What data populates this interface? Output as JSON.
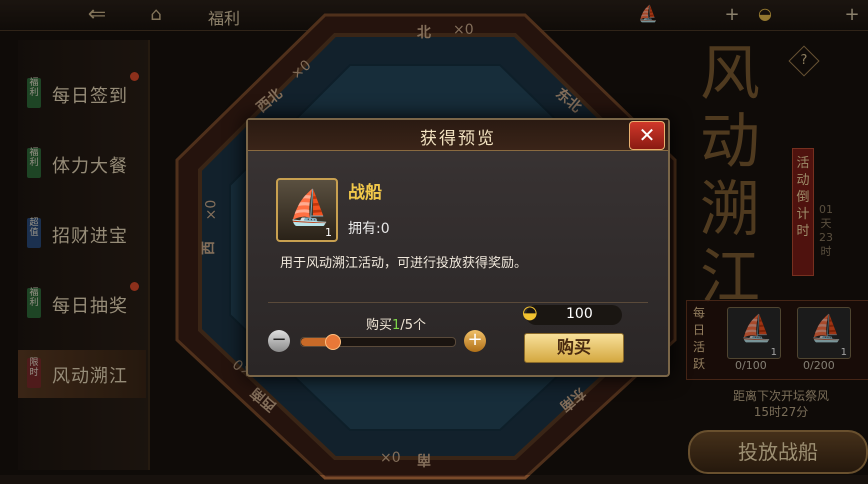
{
  "topbar": {
    "back_icon": "back-arrow-icon",
    "home_icon": "home-icon",
    "title": "福利",
    "resource1_icon": "ship-resource-icon",
    "resource2_icon": "gold-ingot-icon"
  },
  "sidebar": {
    "items": [
      {
        "tag": "福利",
        "label": "每日签到",
        "badge": true,
        "tag_color": "#2f6a3a"
      },
      {
        "tag": "福利",
        "label": "体力大餐",
        "badge": false,
        "tag_color": "#2f6a3a"
      },
      {
        "tag": "超值",
        "label": "招财进宝",
        "badge": false,
        "tag_color": "#2a4a7a"
      },
      {
        "tag": "福利",
        "label": "每日抽奖",
        "badge": true,
        "tag_color": "#2f6a3a"
      },
      {
        "tag": "限时",
        "label": "风动溯江",
        "badge": false,
        "tag_color": "#7a2a2a"
      }
    ]
  },
  "board": {
    "north": "北",
    "north_count": "×0",
    "northwest": "西北",
    "northwest_count": "×0",
    "northeast": "东北",
    "west_count": "×0",
    "west": "西",
    "south_count": "×0",
    "south": "南",
    "southwest": "西南",
    "southwest_count": "×0",
    "southeast": "东南"
  },
  "event": {
    "title_chars": [
      "风",
      "动",
      "溯",
      "江"
    ],
    "help": "?",
    "countdown_label": [
      "活",
      "动",
      "倒",
      "计",
      "时"
    ],
    "countdown_values": [
      "01",
      "天",
      "23",
      "时"
    ],
    "daily_label": [
      "每",
      "日",
      "活",
      "跃"
    ],
    "slots": [
      {
        "count": "1",
        "progress": "0/100"
      },
      {
        "count": "1",
        "progress": "0/200"
      }
    ],
    "next_info_1": "距离下次开坛祭风",
    "next_info_2": "15时27分",
    "cast_button": "投放战船"
  },
  "modal": {
    "title": "获得预览",
    "close": "✕",
    "item_name": "战船",
    "item_qty": "1",
    "owned": "拥有:0",
    "description": "用于风动溯江活动，可进行投放获得奖励。",
    "buy_prefix": "购买",
    "buy_current": "1",
    "buy_suffix": "/5个",
    "buy_fraction": 0.2,
    "price": "100",
    "buy_button": "购买",
    "minus": "−",
    "plus": "+"
  }
}
